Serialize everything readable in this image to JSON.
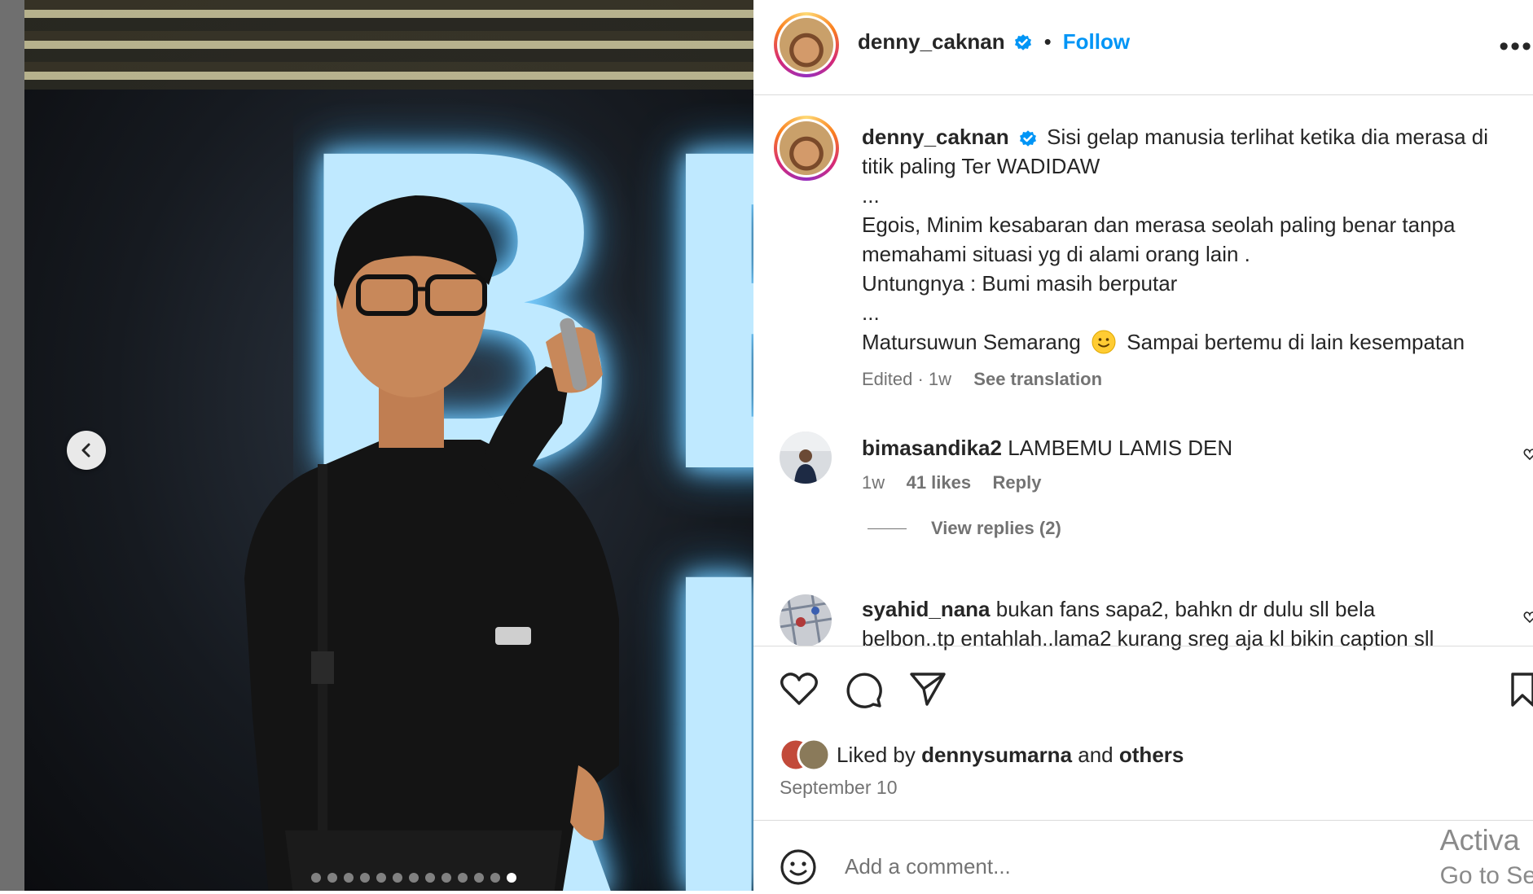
{
  "post": {
    "author": "denny_caknan",
    "follow_label": "Follow",
    "separator": "•",
    "more_label": "•••",
    "caption_lines": [
      "Sisi gelap manusia terlihat ketika dia merasa di",
      "titik paling Ter WADIDAW",
      "...",
      "Egois, Minim kesabaran dan merasa seolah paling benar tanpa",
      "memahami situasi yg di alami orang lain .",
      "Untungnya : Bumi masih berputar",
      "...",
      "Matursuwun Semarang",
      "Sampai bertemu di lain kesempatan"
    ],
    "edited": "Edited · 1w",
    "see_translation": "See translation",
    "media_text": "BE\nAI"
  },
  "comments": [
    {
      "user": "bimasandika2",
      "text": "LAMBEMU LAMIS DEN",
      "time": "1w",
      "likes": "41 likes",
      "reply": "Reply",
      "view_replies": "View replies (2)"
    },
    {
      "user": "syahid_nana",
      "text_line1": "bukan fans sapa2, bahkn dr dulu sll bela",
      "text_line2": "belbon..tp entahlah..lama2 kurang sreg aja kl bikin caption sll"
    }
  ],
  "likes": {
    "liked_by_prefix": "Liked by",
    "liked_by_user": "dennysumarna",
    "and_label": "and",
    "others_label": "others",
    "date": "September 10"
  },
  "composer": {
    "placeholder": "Add a comment..."
  },
  "overlay": {
    "line1": "Activa",
    "line2": "Go to Se"
  },
  "carousel": {
    "total": 13,
    "active_index": 12
  },
  "colors": {
    "accent": "#0095f6",
    "verified": "#0095f6",
    "text": "#262626",
    "muted": "#737373"
  },
  "icons": [
    "chevron-left-icon",
    "verified-icon",
    "more-icon",
    "heart-icon",
    "comment-icon",
    "share-icon",
    "bookmark-icon",
    "emoji-icon",
    "smiley-emoji-icon"
  ]
}
